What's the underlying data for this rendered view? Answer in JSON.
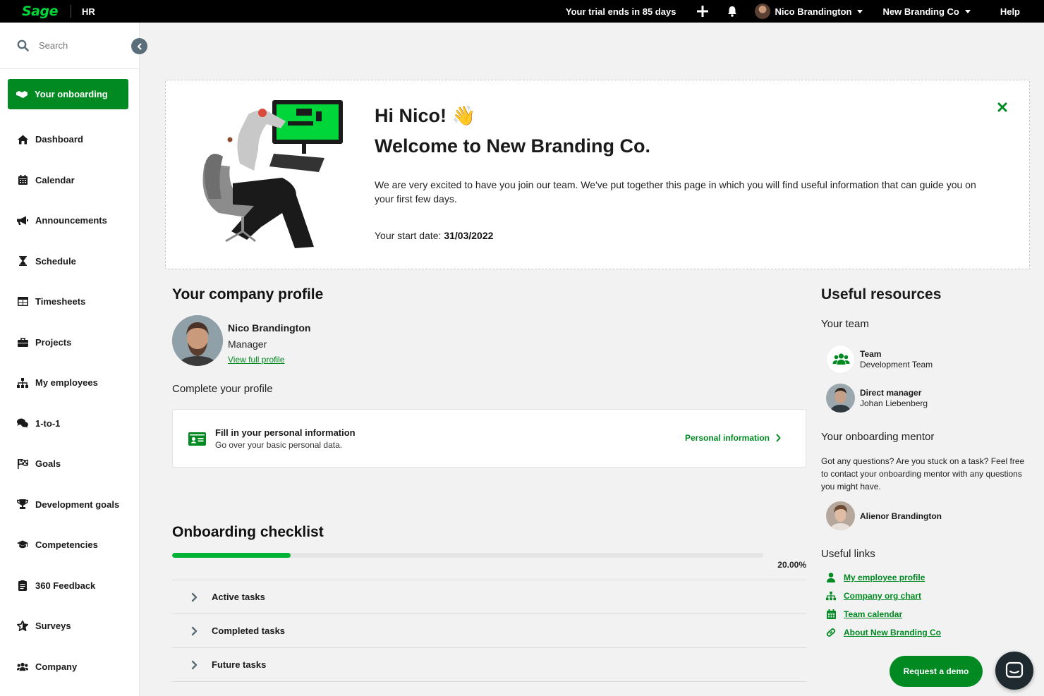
{
  "topbar": {
    "logo": "Sage",
    "product": "HR",
    "trial": "Your trial ends in 85 days",
    "user_name": "Nico Brandington",
    "company": "New Branding Co",
    "help": "Help"
  },
  "sidebar": {
    "search_placeholder": "Search",
    "items": [
      {
        "label": "Your onboarding",
        "icon": "handshake-icon",
        "active": true
      },
      {
        "label": "Dashboard",
        "icon": "home-icon"
      },
      {
        "label": "Calendar",
        "icon": "calendar-icon"
      },
      {
        "label": "Announcements",
        "icon": "megaphone-icon"
      },
      {
        "label": "Schedule",
        "icon": "hourglass-icon"
      },
      {
        "label": "Timesheets",
        "icon": "table-icon"
      },
      {
        "label": "Projects",
        "icon": "briefcase-icon"
      },
      {
        "label": "My employees",
        "icon": "org-chart-icon"
      },
      {
        "label": "1-to-1",
        "icon": "chat-bubbles-icon"
      },
      {
        "label": "Goals",
        "icon": "flag-icon"
      },
      {
        "label": "Development goals",
        "icon": "trophy-icon"
      },
      {
        "label": "Competencies",
        "icon": "graduation-cap-icon"
      },
      {
        "label": "360 Feedback",
        "icon": "clipboard-icon"
      },
      {
        "label": "Surveys",
        "icon": "star-icon"
      },
      {
        "label": "Company",
        "icon": "users-icon"
      }
    ]
  },
  "welcome": {
    "greeting": "Hi Nico! 👋",
    "title": "Welcome to New Branding Co.",
    "text": "We are very excited to have you join our team. We've put together this page in which you will find useful information that can guide you on your first few days.",
    "start_label": "Your start date:",
    "start_date": "31/03/2022"
  },
  "profile": {
    "section_title": "Your company profile",
    "name": "Nico Brandington",
    "role": "Manager",
    "link": "View full profile",
    "complete_label": "Complete your profile",
    "card_title": "Fill in your personal information",
    "card_sub": "Go over your basic personal data.",
    "card_link": "Personal information"
  },
  "checklist": {
    "title": "Onboarding checklist",
    "progress": 0.2,
    "progress_label": "20.00%",
    "rows": [
      "Active tasks",
      "Completed tasks",
      "Future tasks"
    ]
  },
  "resources": {
    "title": "Useful resources",
    "team_heading": "Your team",
    "team_label": "Team",
    "team_value": "Development Team",
    "manager_label": "Direct manager",
    "manager_value": "Johan Liebenberg",
    "mentor_heading": "Your onboarding mentor",
    "mentor_text": "Got any questions? Are you stuck on a task? Feel free to contact your onboarding mentor with any questions you might have.",
    "mentor_name": "Alienor Brandington",
    "links_heading": "Useful links",
    "links": [
      {
        "label": "My employee profile",
        "icon": "user-icon"
      },
      {
        "label": "Company org chart",
        "icon": "org-chart-icon"
      },
      {
        "label": "Team calendar",
        "icon": "calendar-icon"
      },
      {
        "label": "About New Branding Co",
        "icon": "link-icon"
      }
    ]
  },
  "demo_button": "Request a demo",
  "colors": {
    "brand_green": "#008a21",
    "logo_green": "#00d639",
    "topbar": "#000000"
  }
}
